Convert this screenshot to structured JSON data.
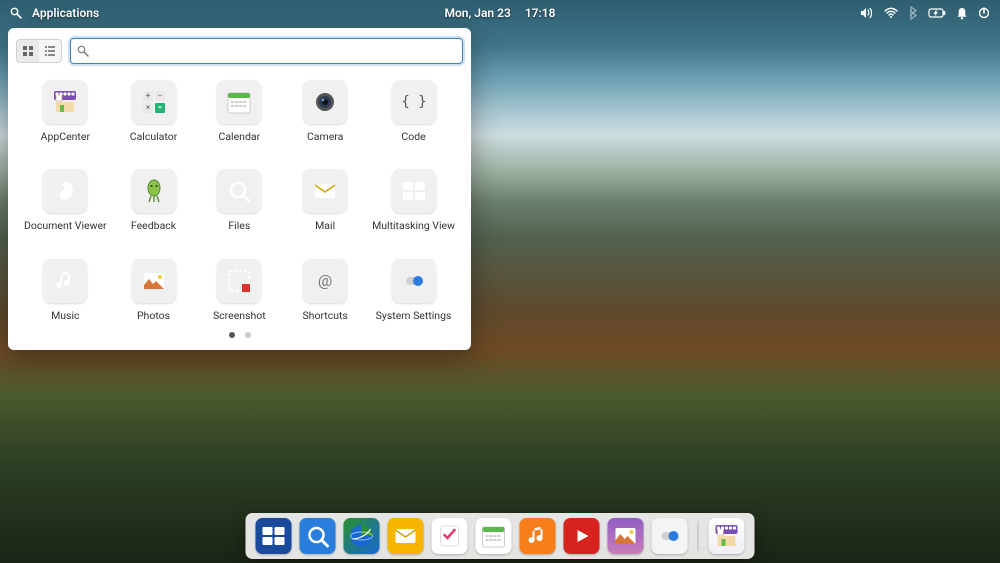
{
  "topbar": {
    "applications_label": "Applications",
    "date": "Mon, Jan 23",
    "time": "17:18"
  },
  "panel": {
    "search_placeholder": "",
    "apps": [
      {
        "name": "AppCenter",
        "icon": "appcenter"
      },
      {
        "name": "Calculator",
        "icon": "calculator"
      },
      {
        "name": "Calendar",
        "icon": "calendar"
      },
      {
        "name": "Camera",
        "icon": "camera"
      },
      {
        "name": "Code",
        "icon": "code"
      },
      {
        "name": "Document Viewer",
        "icon": "docviewer"
      },
      {
        "name": "Feedback",
        "icon": "feedback"
      },
      {
        "name": "Files",
        "icon": "files"
      },
      {
        "name": "Mail",
        "icon": "mail"
      },
      {
        "name": "Multitasking View",
        "icon": "multitask"
      },
      {
        "name": "Music",
        "icon": "music"
      },
      {
        "name": "Photos",
        "icon": "photos"
      },
      {
        "name": "Screenshot",
        "icon": "screenshot"
      },
      {
        "name": "Shortcuts",
        "icon": "shortcuts"
      },
      {
        "name": "System Settings",
        "icon": "settings"
      }
    ],
    "pages": 2,
    "active_page": 0
  },
  "dock": {
    "items": [
      {
        "name": "Multitasking View",
        "icon": "multitask"
      },
      {
        "name": "Files",
        "icon": "files"
      },
      {
        "name": "Web",
        "icon": "web"
      },
      {
        "name": "Mail",
        "icon": "mail"
      },
      {
        "name": "Tasks",
        "icon": "tasks"
      },
      {
        "name": "Calendar",
        "icon": "calendar"
      },
      {
        "name": "Music",
        "icon": "music"
      },
      {
        "name": "Videos",
        "icon": "video"
      },
      {
        "name": "Photos",
        "icon": "photos"
      },
      {
        "name": "System Settings",
        "icon": "settings"
      },
      {
        "name": "AppCenter",
        "icon": "appcenter"
      }
    ]
  }
}
